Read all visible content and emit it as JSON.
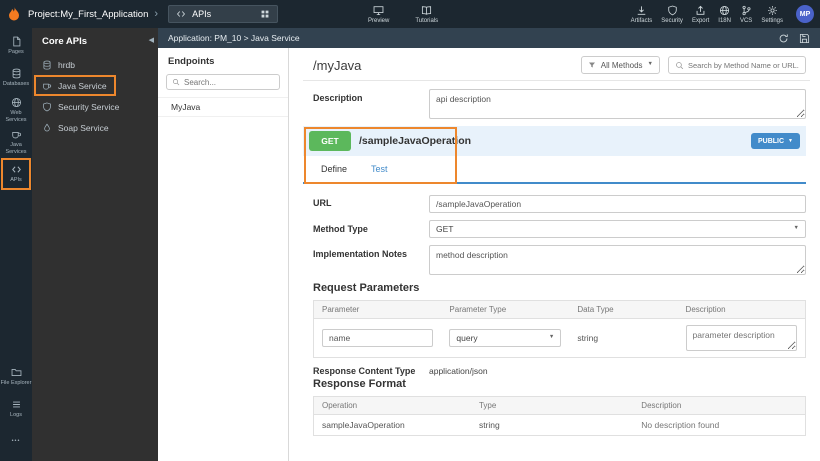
{
  "topbar": {
    "project": "Project:My_First_Application",
    "workspace_tab": "APIs",
    "preview": "Preview",
    "tutorials": "Tutorials",
    "tools": [
      {
        "label": "Artifacts"
      },
      {
        "label": "Security"
      },
      {
        "label": "Export"
      },
      {
        "label": "I18N"
      },
      {
        "label": "VCS"
      },
      {
        "label": "Settings"
      }
    ],
    "avatar": "MP"
  },
  "rail": {
    "items": [
      {
        "label": "Pages"
      },
      {
        "label": "Databases"
      },
      {
        "label": "Web Services"
      },
      {
        "label": "Java Services"
      },
      {
        "label": "APIs"
      }
    ],
    "bottom_items": [
      {
        "label": "File Explorer"
      },
      {
        "label": "Logs"
      },
      {
        "label": "•••"
      }
    ]
  },
  "services": {
    "title": "Core APIs",
    "items": [
      {
        "label": "hrdb"
      },
      {
        "label": "Java Service"
      },
      {
        "label": "Security Service"
      },
      {
        "label": "Soap Service"
      }
    ]
  },
  "breadcrumb": "Application: PM_10 > Java Service",
  "endpoints": {
    "title": "Endpoints",
    "search_placeholder": "Search...",
    "items": [
      {
        "label": "MyJava"
      }
    ]
  },
  "main": {
    "title": "/myJava",
    "methods_filter": "All Methods",
    "search_placeholder": "Search by Method Name or URL...",
    "description_label": "Description",
    "description_value": "api description",
    "operation": {
      "method": "GET",
      "path": "/sampleJavaOperation",
      "visibility": "PUBLIC",
      "tabs": [
        {
          "label": "Define"
        },
        {
          "label": "Test"
        }
      ]
    },
    "form": {
      "url_label": "URL",
      "url_value": "/sampleJavaOperation",
      "method_type_label": "Method Type",
      "method_type_value": "GET",
      "impl_notes_label": "Implementation Notes",
      "impl_notes_value": "method description"
    },
    "request_params": {
      "title": "Request Parameters",
      "headers": [
        "Parameter",
        "Parameter Type",
        "Data Type",
        "Description"
      ],
      "row": {
        "parameter_value": "name",
        "parameter_type_value": "query",
        "data_type": "string",
        "description_placeholder": "parameter description"
      }
    },
    "response_content_type_label": "Response Content Type",
    "response_content_type_value": "application/json",
    "response_format": {
      "title": "Response Format",
      "headers": [
        "Operation",
        "Type",
        "Description"
      ],
      "rows": [
        {
          "operation": "sampleJavaOperation",
          "type": "string",
          "description": "No description found"
        }
      ]
    }
  },
  "colors": {
    "annotation_orange": "#ed872d",
    "method_get_green": "#5cb85c",
    "link_blue": "#428bca",
    "topbar_dark": "#1c2730"
  }
}
